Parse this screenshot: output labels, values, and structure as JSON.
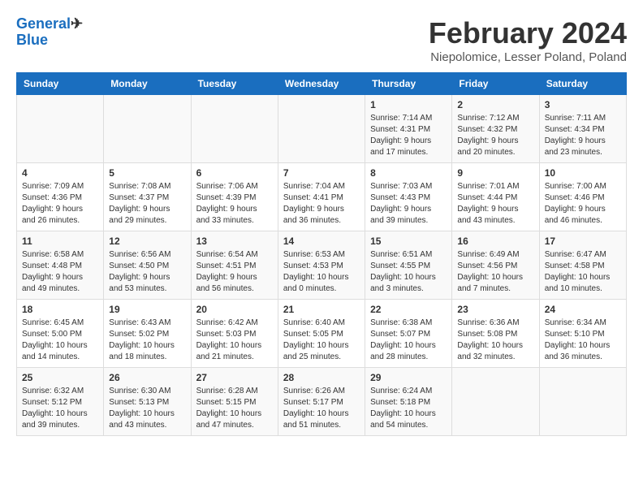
{
  "header": {
    "logo_line1": "General",
    "logo_line2": "Blue",
    "month_title": "February 2024",
    "location": "Niepolomice, Lesser Poland, Poland"
  },
  "weekdays": [
    "Sunday",
    "Monday",
    "Tuesday",
    "Wednesday",
    "Thursday",
    "Friday",
    "Saturday"
  ],
  "weeks": [
    [
      {
        "day": "",
        "info": ""
      },
      {
        "day": "",
        "info": ""
      },
      {
        "day": "",
        "info": ""
      },
      {
        "day": "",
        "info": ""
      },
      {
        "day": "1",
        "info": "Sunrise: 7:14 AM\nSunset: 4:31 PM\nDaylight: 9 hours\nand 17 minutes."
      },
      {
        "day": "2",
        "info": "Sunrise: 7:12 AM\nSunset: 4:32 PM\nDaylight: 9 hours\nand 20 minutes."
      },
      {
        "day": "3",
        "info": "Sunrise: 7:11 AM\nSunset: 4:34 PM\nDaylight: 9 hours\nand 23 minutes."
      }
    ],
    [
      {
        "day": "4",
        "info": "Sunrise: 7:09 AM\nSunset: 4:36 PM\nDaylight: 9 hours\nand 26 minutes."
      },
      {
        "day": "5",
        "info": "Sunrise: 7:08 AM\nSunset: 4:37 PM\nDaylight: 9 hours\nand 29 minutes."
      },
      {
        "day": "6",
        "info": "Sunrise: 7:06 AM\nSunset: 4:39 PM\nDaylight: 9 hours\nand 33 minutes."
      },
      {
        "day": "7",
        "info": "Sunrise: 7:04 AM\nSunset: 4:41 PM\nDaylight: 9 hours\nand 36 minutes."
      },
      {
        "day": "8",
        "info": "Sunrise: 7:03 AM\nSunset: 4:43 PM\nDaylight: 9 hours\nand 39 minutes."
      },
      {
        "day": "9",
        "info": "Sunrise: 7:01 AM\nSunset: 4:44 PM\nDaylight: 9 hours\nand 43 minutes."
      },
      {
        "day": "10",
        "info": "Sunrise: 7:00 AM\nSunset: 4:46 PM\nDaylight: 9 hours\nand 46 minutes."
      }
    ],
    [
      {
        "day": "11",
        "info": "Sunrise: 6:58 AM\nSunset: 4:48 PM\nDaylight: 9 hours\nand 49 minutes."
      },
      {
        "day": "12",
        "info": "Sunrise: 6:56 AM\nSunset: 4:50 PM\nDaylight: 9 hours\nand 53 minutes."
      },
      {
        "day": "13",
        "info": "Sunrise: 6:54 AM\nSunset: 4:51 PM\nDaylight: 9 hours\nand 56 minutes."
      },
      {
        "day": "14",
        "info": "Sunrise: 6:53 AM\nSunset: 4:53 PM\nDaylight: 10 hours\nand 0 minutes."
      },
      {
        "day": "15",
        "info": "Sunrise: 6:51 AM\nSunset: 4:55 PM\nDaylight: 10 hours\nand 3 minutes."
      },
      {
        "day": "16",
        "info": "Sunrise: 6:49 AM\nSunset: 4:56 PM\nDaylight: 10 hours\nand 7 minutes."
      },
      {
        "day": "17",
        "info": "Sunrise: 6:47 AM\nSunset: 4:58 PM\nDaylight: 10 hours\nand 10 minutes."
      }
    ],
    [
      {
        "day": "18",
        "info": "Sunrise: 6:45 AM\nSunset: 5:00 PM\nDaylight: 10 hours\nand 14 minutes."
      },
      {
        "day": "19",
        "info": "Sunrise: 6:43 AM\nSunset: 5:02 PM\nDaylight: 10 hours\nand 18 minutes."
      },
      {
        "day": "20",
        "info": "Sunrise: 6:42 AM\nSunset: 5:03 PM\nDaylight: 10 hours\nand 21 minutes."
      },
      {
        "day": "21",
        "info": "Sunrise: 6:40 AM\nSunset: 5:05 PM\nDaylight: 10 hours\nand 25 minutes."
      },
      {
        "day": "22",
        "info": "Sunrise: 6:38 AM\nSunset: 5:07 PM\nDaylight: 10 hours\nand 28 minutes."
      },
      {
        "day": "23",
        "info": "Sunrise: 6:36 AM\nSunset: 5:08 PM\nDaylight: 10 hours\nand 32 minutes."
      },
      {
        "day": "24",
        "info": "Sunrise: 6:34 AM\nSunset: 5:10 PM\nDaylight: 10 hours\nand 36 minutes."
      }
    ],
    [
      {
        "day": "25",
        "info": "Sunrise: 6:32 AM\nSunset: 5:12 PM\nDaylight: 10 hours\nand 39 minutes."
      },
      {
        "day": "26",
        "info": "Sunrise: 6:30 AM\nSunset: 5:13 PM\nDaylight: 10 hours\nand 43 minutes."
      },
      {
        "day": "27",
        "info": "Sunrise: 6:28 AM\nSunset: 5:15 PM\nDaylight: 10 hours\nand 47 minutes."
      },
      {
        "day": "28",
        "info": "Sunrise: 6:26 AM\nSunset: 5:17 PM\nDaylight: 10 hours\nand 51 minutes."
      },
      {
        "day": "29",
        "info": "Sunrise: 6:24 AM\nSunset: 5:18 PM\nDaylight: 10 hours\nand 54 minutes."
      },
      {
        "day": "",
        "info": ""
      },
      {
        "day": "",
        "info": ""
      }
    ]
  ]
}
